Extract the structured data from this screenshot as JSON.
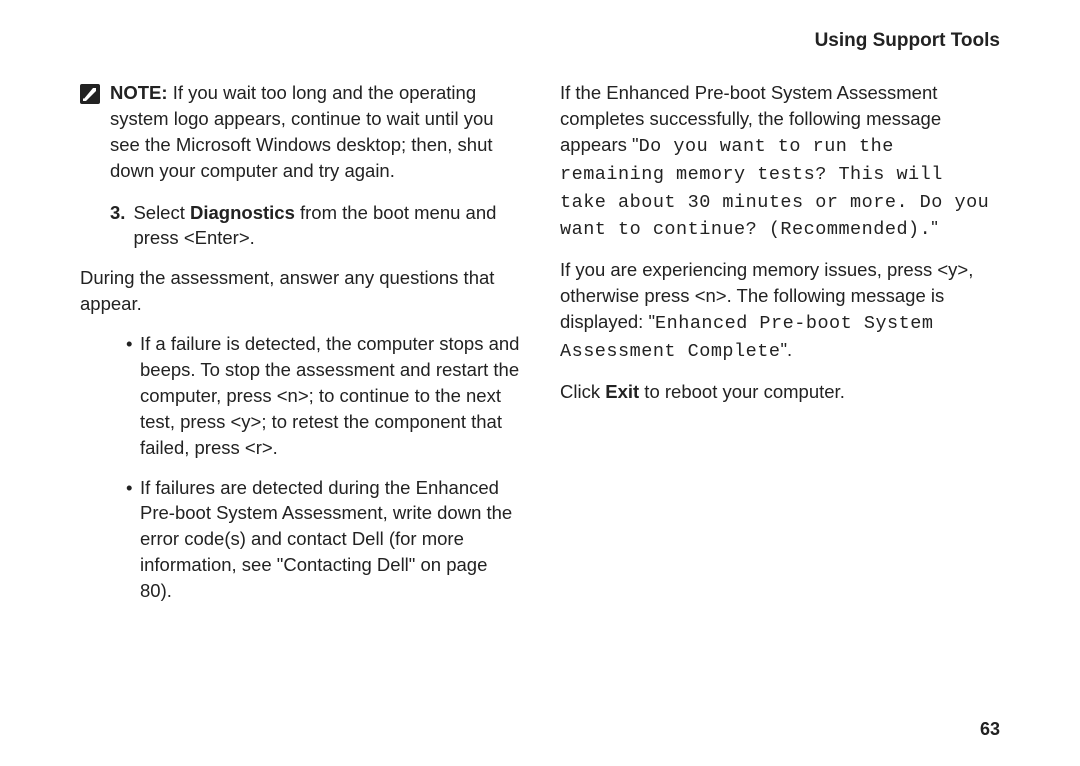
{
  "header": "Using Support Tools",
  "pageNumber": "63",
  "left": {
    "noteLabel": "NOTE:",
    "noteBody": " If you wait too long and the operating system logo appears, continue to wait until you see the Microsoft Windows desktop; then, shut down your computer and try again.",
    "step3num": "3.",
    "step3a": "Select ",
    "step3bold": "Diagnostics",
    "step3b": " from the boot menu and press <Enter>.",
    "answer": "During the assessment, answer any questions that appear.",
    "bullet1": "If a failure is detected, the computer stops and beeps. To stop the assessment and restart the computer, press <n>; to continue to the next test, press <y>; to retest the component that failed, press <r>.",
    "bullet2": "If failures are detected during the Enhanced Pre-boot System Assessment, write down the error code(s) and contact Dell (for more information, see \"Contacting Dell\" on page 80)."
  },
  "right": {
    "p1a": "If the Enhanced Pre-boot System Assessment completes successfully, the following message appears \"",
    "p1mono": "Do you want to run the remaining memory tests? This will take about 30 minutes or more. Do you want to continue? (Recommended).",
    "p1b": "\"",
    "p2a": "If you are experiencing memory issues, press <y>, otherwise press <n>. The following message is displayed: \"",
    "p2mono": "Enhanced Pre-boot System Assessment Complete",
    "p2b": "\".",
    "p3a": "Click ",
    "p3bold": "Exit",
    "p3b": " to reboot your computer."
  }
}
